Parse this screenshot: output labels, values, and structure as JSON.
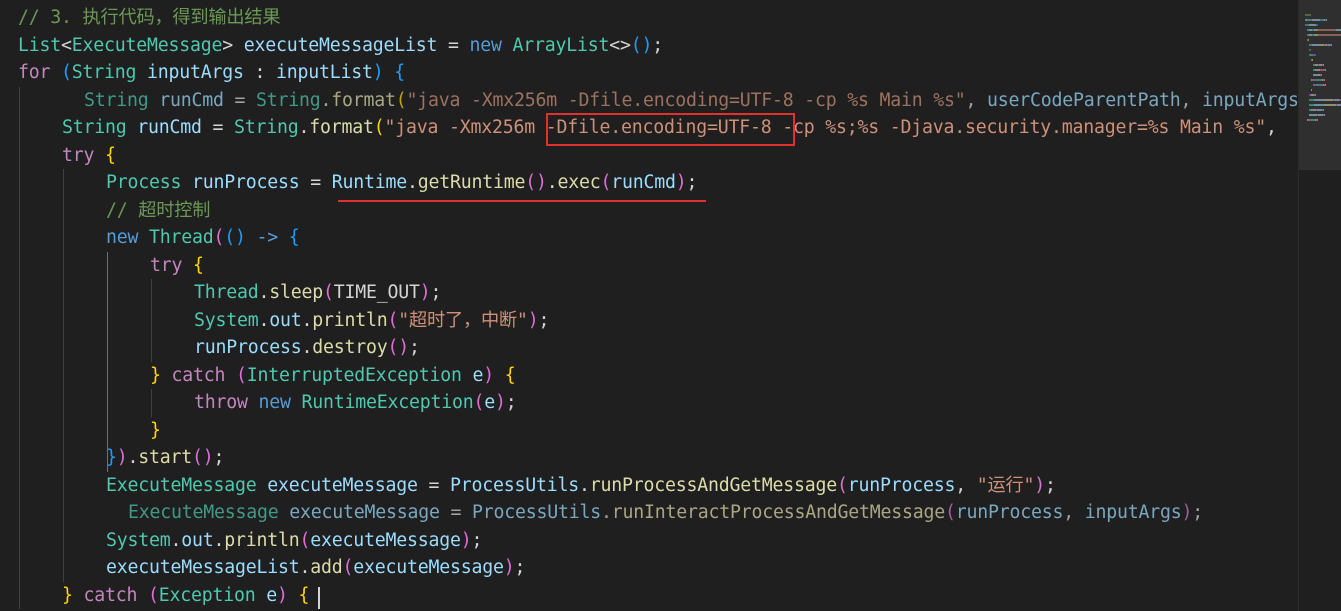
{
  "editor": {
    "colors": {
      "background": "#1f1f1f",
      "comment": "#6a9955",
      "keyword": "#569cd6",
      "control": "#c586c0",
      "type": "#4ec9b0",
      "variable": "#9cdcfe",
      "function": "#dcdcaa",
      "string": "#ce9178",
      "plain": "#d4d4d4",
      "bracket1": "#ffd700",
      "bracket2": "#da70d6",
      "bracket3": "#179fff",
      "annotation": "#e0312e"
    },
    "lines": [
      {
        "indent": 0,
        "tokens": [
          {
            "t": "// 3. 执行代码，得到输出结果",
            "c": "comment"
          }
        ]
      },
      {
        "indent": 0,
        "tokens": [
          {
            "t": "List",
            "c": "type"
          },
          {
            "t": "<",
            "c": "plain"
          },
          {
            "t": "ExecuteMessage",
            "c": "type"
          },
          {
            "t": "> ",
            "c": "plain"
          },
          {
            "t": "executeMessageList",
            "c": "variable"
          },
          {
            "t": " = ",
            "c": "plain"
          },
          {
            "t": "new ",
            "c": "keyword"
          },
          {
            "t": "ArrayList",
            "c": "type"
          },
          {
            "t": "<>",
            "c": "plain"
          },
          {
            "t": "()",
            "c": "bracket3"
          },
          {
            "t": ";",
            "c": "plain"
          }
        ]
      },
      {
        "indent": 0,
        "tokens": [
          {
            "t": "for ",
            "c": "control"
          },
          {
            "t": "(",
            "c": "bracket3"
          },
          {
            "t": "String ",
            "c": "type"
          },
          {
            "t": "inputArgs",
            "c": "variable"
          },
          {
            "t": " : ",
            "c": "plain"
          },
          {
            "t": "inputList",
            "c": "variable"
          },
          {
            "t": ") ",
            "c": "bracket3"
          },
          {
            "t": "{",
            "c": "bracket3"
          }
        ]
      },
      {
        "indent": 1,
        "offset": 22,
        "faded": true,
        "tokens": [
          {
            "t": "String ",
            "c": "type"
          },
          {
            "t": "runCmd",
            "c": "variable"
          },
          {
            "t": " = ",
            "c": "plain"
          },
          {
            "t": "String",
            "c": "type"
          },
          {
            "t": ".",
            "c": "plain"
          },
          {
            "t": "format",
            "c": "function"
          },
          {
            "t": "(",
            "c": "bracket1"
          },
          {
            "t": "\"java -Xmx256m -Dfile.encoding=UTF-8 -cp %s Main %s\"",
            "c": "string"
          },
          {
            "t": ", ",
            "c": "plain"
          },
          {
            "t": "userCodeParentPath",
            "c": "variable"
          },
          {
            "t": ", ",
            "c": "plain"
          },
          {
            "t": "inputArgs",
            "c": "variable"
          }
        ]
      },
      {
        "indent": 1,
        "tokens": [
          {
            "t": "String ",
            "c": "type"
          },
          {
            "t": "runCmd",
            "c": "variable"
          },
          {
            "t": " = ",
            "c": "plain"
          },
          {
            "t": "String",
            "c": "type"
          },
          {
            "t": ".",
            "c": "plain"
          },
          {
            "t": "format",
            "c": "function"
          },
          {
            "t": "(",
            "c": "bracket1"
          },
          {
            "t": "\"java -Xmx256m -Dfile.encoding=UTF-8 -cp %s;%s -Djava.security.manager=%s Main %s\"",
            "c": "string"
          },
          {
            "t": ", ",
            "c": "plain"
          }
        ]
      },
      {
        "indent": 1,
        "tokens": [
          {
            "t": "try ",
            "c": "control"
          },
          {
            "t": "{",
            "c": "bracket1"
          }
        ]
      },
      {
        "indent": 2,
        "tokens": [
          {
            "t": "Process ",
            "c": "type"
          },
          {
            "t": "runProcess",
            "c": "variable"
          },
          {
            "t": " = ",
            "c": "plain"
          },
          {
            "t": "Runtime",
            "c": "variable"
          },
          {
            "t": ".",
            "c": "plain"
          },
          {
            "t": "getRuntime",
            "c": "function"
          },
          {
            "t": "()",
            "c": "bracket2"
          },
          {
            "t": ".",
            "c": "plain"
          },
          {
            "t": "exec",
            "c": "function"
          },
          {
            "t": "(",
            "c": "bracket2"
          },
          {
            "t": "runCmd",
            "c": "variable"
          },
          {
            "t": ")",
            "c": "bracket2"
          },
          {
            "t": ";",
            "c": "plain"
          }
        ]
      },
      {
        "indent": 2,
        "tokens": [
          {
            "t": "// 超时控制",
            "c": "comment"
          }
        ]
      },
      {
        "indent": 2,
        "tokens": [
          {
            "t": "new ",
            "c": "keyword"
          },
          {
            "t": "Thread",
            "c": "type"
          },
          {
            "t": "(",
            "c": "bracket2"
          },
          {
            "t": "()",
            "c": "bracket3"
          },
          {
            "t": " -> ",
            "c": "keyword"
          },
          {
            "t": "{",
            "c": "bracket3"
          }
        ]
      },
      {
        "indent": 3,
        "tokens": [
          {
            "t": "try ",
            "c": "control"
          },
          {
            "t": "{",
            "c": "bracket1"
          }
        ]
      },
      {
        "indent": 4,
        "tokens": [
          {
            "t": "Thread",
            "c": "type"
          },
          {
            "t": ".",
            "c": "plain"
          },
          {
            "t": "sleep",
            "c": "function"
          },
          {
            "t": "(",
            "c": "bracket2"
          },
          {
            "t": "TIME_OUT",
            "c": "plain"
          },
          {
            "t": ")",
            "c": "bracket2"
          },
          {
            "t": ";",
            "c": "plain"
          }
        ]
      },
      {
        "indent": 4,
        "tokens": [
          {
            "t": "System",
            "c": "type"
          },
          {
            "t": ".",
            "c": "plain"
          },
          {
            "t": "out",
            "c": "variable"
          },
          {
            "t": ".",
            "c": "plain"
          },
          {
            "t": "println",
            "c": "function"
          },
          {
            "t": "(",
            "c": "bracket2"
          },
          {
            "t": "\"超时了，中断\"",
            "c": "string"
          },
          {
            "t": ")",
            "c": "bracket2"
          },
          {
            "t": ";",
            "c": "plain"
          }
        ]
      },
      {
        "indent": 4,
        "tokens": [
          {
            "t": "runProcess",
            "c": "variable"
          },
          {
            "t": ".",
            "c": "plain"
          },
          {
            "t": "destroy",
            "c": "function"
          },
          {
            "t": "()",
            "c": "bracket2"
          },
          {
            "t": ";",
            "c": "plain"
          }
        ]
      },
      {
        "indent": 3,
        "tokens": [
          {
            "t": "} ",
            "c": "bracket1"
          },
          {
            "t": "catch ",
            "c": "control"
          },
          {
            "t": "(",
            "c": "bracket2"
          },
          {
            "t": "InterruptedException ",
            "c": "type"
          },
          {
            "t": "e",
            "c": "variable"
          },
          {
            "t": ") ",
            "c": "bracket2"
          },
          {
            "t": "{",
            "c": "bracket1"
          }
        ]
      },
      {
        "indent": 4,
        "tokens": [
          {
            "t": "throw ",
            "c": "control"
          },
          {
            "t": "new ",
            "c": "keyword"
          },
          {
            "t": "RuntimeException",
            "c": "type"
          },
          {
            "t": "(",
            "c": "bracket2"
          },
          {
            "t": "e",
            "c": "variable"
          },
          {
            "t": ")",
            "c": "bracket2"
          },
          {
            "t": ";",
            "c": "plain"
          }
        ]
      },
      {
        "indent": 3,
        "tokens": [
          {
            "t": "}",
            "c": "bracket1"
          }
        ]
      },
      {
        "indent": 2,
        "tokens": [
          {
            "t": "}",
            "c": "bracket3"
          },
          {
            "t": ")",
            "c": "bracket2"
          },
          {
            "t": ".",
            "c": "plain"
          },
          {
            "t": "start",
            "c": "function"
          },
          {
            "t": "()",
            "c": "bracket2"
          },
          {
            "t": ";",
            "c": "plain"
          }
        ]
      },
      {
        "indent": 2,
        "tokens": [
          {
            "t": "ExecuteMessage ",
            "c": "type"
          },
          {
            "t": "executeMessage",
            "c": "variable"
          },
          {
            "t": " = ",
            "c": "plain"
          },
          {
            "t": "ProcessUtils",
            "c": "variable"
          },
          {
            "t": ".",
            "c": "plain"
          },
          {
            "t": "runProcessAndGetMessage",
            "c": "function"
          },
          {
            "t": "(",
            "c": "bracket2"
          },
          {
            "t": "runProcess",
            "c": "variable"
          },
          {
            "t": ", ",
            "c": "plain"
          },
          {
            "t": "\"运行\"",
            "c": "string"
          },
          {
            "t": ")",
            "c": "bracket2"
          },
          {
            "t": ";",
            "c": "plain"
          }
        ]
      },
      {
        "indent": 2,
        "offset": 22,
        "faded": true,
        "tokens": [
          {
            "t": "ExecuteMessage ",
            "c": "type"
          },
          {
            "t": "executeMessage",
            "c": "variable"
          },
          {
            "t": " = ",
            "c": "plain"
          },
          {
            "t": "ProcessUtils",
            "c": "variable"
          },
          {
            "t": ".",
            "c": "plain"
          },
          {
            "t": "runInteractProcessAndGetMessage",
            "c": "function"
          },
          {
            "t": "(",
            "c": "bracket2"
          },
          {
            "t": "runProcess",
            "c": "variable"
          },
          {
            "t": ", ",
            "c": "plain"
          },
          {
            "t": "inputArgs",
            "c": "variable"
          },
          {
            "t": ")",
            "c": "bracket2"
          },
          {
            "t": ";",
            "c": "plain"
          }
        ]
      },
      {
        "indent": 2,
        "tokens": [
          {
            "t": "System",
            "c": "type"
          },
          {
            "t": ".",
            "c": "plain"
          },
          {
            "t": "out",
            "c": "variable"
          },
          {
            "t": ".",
            "c": "plain"
          },
          {
            "t": "println",
            "c": "function"
          },
          {
            "t": "(",
            "c": "bracket2"
          },
          {
            "t": "executeMessage",
            "c": "variable"
          },
          {
            "t": ")",
            "c": "bracket2"
          },
          {
            "t": ";",
            "c": "plain"
          }
        ]
      },
      {
        "indent": 2,
        "tokens": [
          {
            "t": "executeMessageList",
            "c": "variable"
          },
          {
            "t": ".",
            "c": "plain"
          },
          {
            "t": "add",
            "c": "function"
          },
          {
            "t": "(",
            "c": "bracket2"
          },
          {
            "t": "executeMessage",
            "c": "variable"
          },
          {
            "t": ")",
            "c": "bracket2"
          },
          {
            "t": ";",
            "c": "plain"
          }
        ]
      },
      {
        "indent": 1,
        "tokens": [
          {
            "t": "} ",
            "c": "bracket1"
          },
          {
            "t": "catch ",
            "c": "control"
          },
          {
            "t": "(",
            "c": "bracket2"
          },
          {
            "t": "Exception ",
            "c": "type"
          },
          {
            "t": "e",
            "c": "variable"
          },
          {
            "t": ") ",
            "c": "bracket2"
          },
          {
            "t": "{",
            "c": "bracket1"
          }
        ]
      }
    ]
  }
}
